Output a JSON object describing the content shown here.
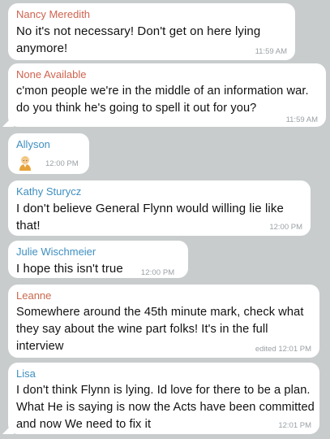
{
  "colors": {
    "background": "#c8cccd",
    "bubble": "#ffffff",
    "time": "#9aa1a5"
  },
  "messages": [
    {
      "sender": "Nancy Meredith",
      "sender_color": "#d0634f",
      "text": "No it's not necessary!  Don't get on here lying anymore!",
      "time": "11:59 AM"
    },
    {
      "sender": "None Available",
      "sender_color": "#d0634f",
      "text": "c'mon people we're in the middle of an information war. do you think he's going to spell it out for you?",
      "time": "11:59 AM"
    },
    {
      "sender": "Allyson",
      "sender_color": "#3f8fc0",
      "emoji": "person-with-blond-hair-emoji",
      "time": "12:00 PM"
    },
    {
      "sender": "Kathy Sturycz",
      "sender_color": "#3f8fc0",
      "text": "I don't believe General Flynn would willing lie like that!",
      "time": "12:00 PM"
    },
    {
      "sender": "Julie Wischmeier",
      "sender_color": "#3f8fc0",
      "text": "I hope this isn't true",
      "time": "12:00 PM"
    },
    {
      "sender": "Leanne",
      "sender_color": "#c96a4d",
      "text": "Somewhere around the 45th minute mark, check what they say about the wine part folks!  It's in the full interview",
      "time": "edited 12:01 PM"
    },
    {
      "sender": "Lisa",
      "sender_color": "#3f8fc0",
      "text": "I don't think Flynn is lying. Id love for there to be a plan. What He is saying is now the Acts have been committed and now We need to fix it",
      "time": "12:01 PM"
    }
  ]
}
